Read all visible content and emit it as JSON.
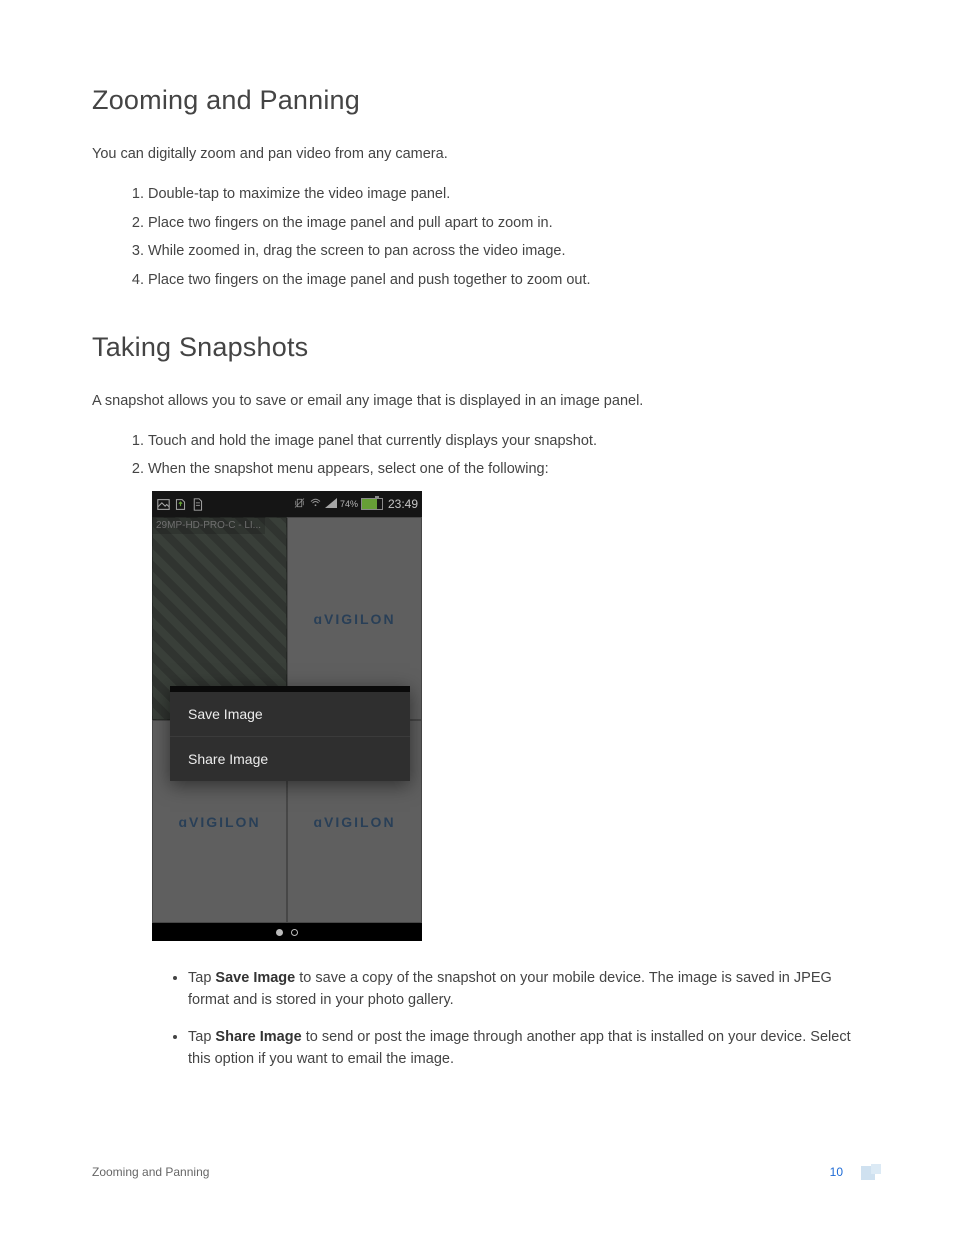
{
  "section1": {
    "title": "Zooming and Panning",
    "intro": "You can digitally zoom and pan video from any camera.",
    "steps": [
      "Double-tap to maximize the video image panel.",
      "Place two fingers on the image panel and pull apart to zoom in.",
      "While zoomed in, drag the screen to pan across the video image.",
      "Place two fingers on the image panel and push together to zoom out."
    ]
  },
  "section2": {
    "title": "Taking Snapshots",
    "intro": "A snapshot allows you to save or email any image that is displayed in an image panel.",
    "steps": [
      "Touch and hold the image panel that currently displays your snapshot.",
      "When the snapshot menu appears, select one of the following:"
    ],
    "bullets": [
      {
        "lead": "Tap ",
        "bold": "Save Image",
        "rest": " to save a copy of the snapshot on your mobile device. The image is saved in JPEG format and is stored in your photo gallery."
      },
      {
        "lead": "Tap ",
        "bold": "Share Image",
        "rest": " to send or post the image through another app that is installed on your device. Select this option if you want to email the image."
      }
    ]
  },
  "screenshot": {
    "camera_label": "29MP-HD-PRO-C - LI...",
    "battery_pct": "74%",
    "clock": "23:49",
    "brand": "ɑVIGILON",
    "menu_items": [
      "Save Image",
      "Share Image"
    ]
  },
  "footer": {
    "section_name": "Zooming and Panning",
    "page_number": "10"
  }
}
